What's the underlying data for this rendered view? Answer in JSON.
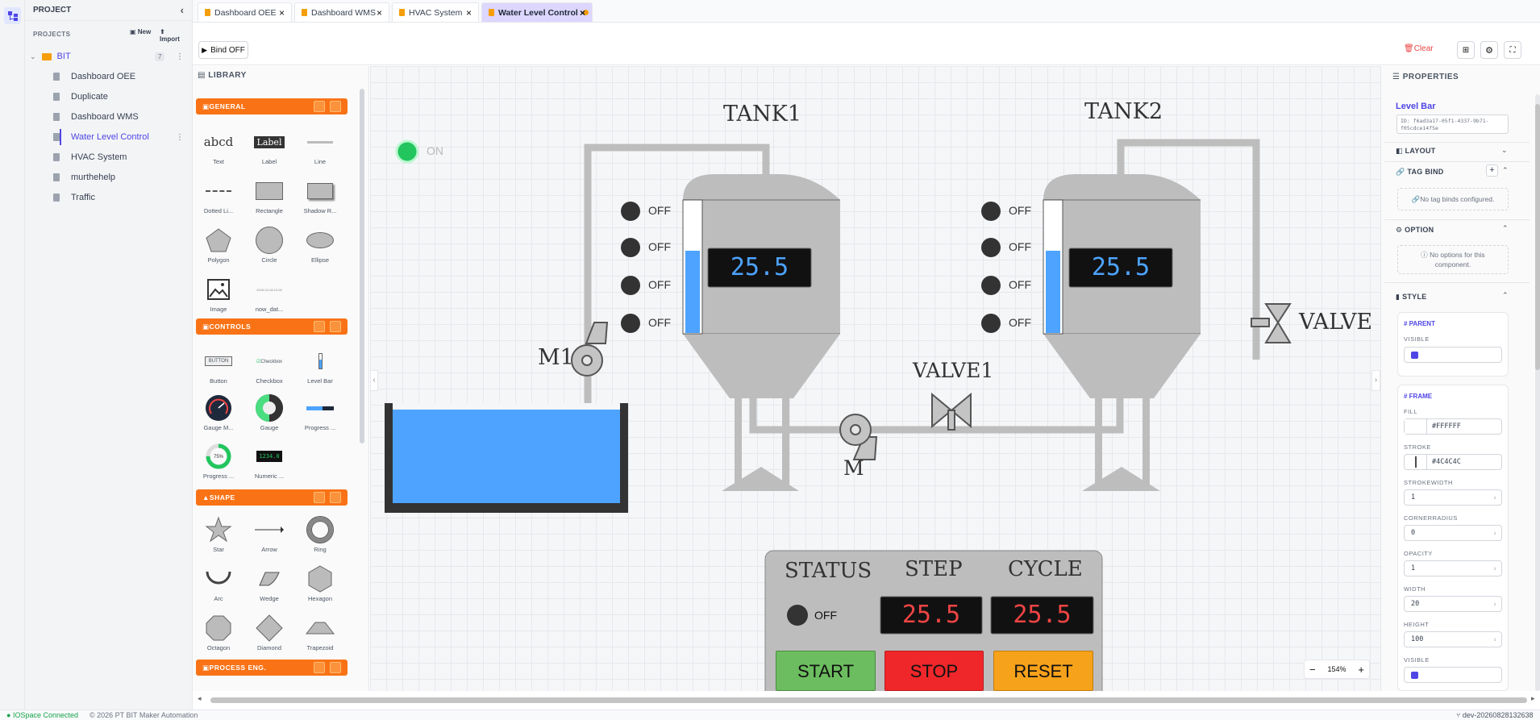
{
  "project": {
    "header": "PROJECT",
    "section": "PROJECTS",
    "new_label": "New",
    "import_label": "Import",
    "folder": "BIT",
    "folder_count": "7",
    "items": [
      "Dashboard OEE",
      "Duplicate",
      "Dashboard WMS",
      "Water Level Control",
      "HVAC System",
      "murthehelp",
      "Traffic"
    ],
    "active_item": "Water Level Control"
  },
  "tabs": [
    {
      "label": "Dashboard OEE"
    },
    {
      "label": "Dashboard WMS"
    },
    {
      "label": "HVAC System"
    },
    {
      "label": "Water Level Control"
    }
  ],
  "toolbar": {
    "bind_label": "Bind OFF",
    "clear_label": "Clear"
  },
  "library": {
    "title": "LIBRARY",
    "categories": [
      "GENERAL",
      "CONTROLS",
      "SHAPE",
      "PROCESS ENG."
    ],
    "general": [
      "Text",
      "Label",
      "Line",
      "Dotted Li...",
      "Rectangle",
      "Shadow R...",
      "Polygon",
      "Circle",
      "Ellipse",
      "Image",
      "now_dat..."
    ],
    "general_text_sample": "abcd",
    "general_label_sample": "Label",
    "general_date_sample": "2026-02-08 12:00",
    "controls": [
      "Button",
      "Checkbox",
      "Level Bar",
      "Gauge M...",
      "Gauge",
      "Progress ...",
      "Progress ...",
      "Numeric ..."
    ],
    "controls_button_sample": "BUTTON",
    "controls_checkbox_sample": "Checkbox",
    "controls_numeric_sample": "1234.0",
    "controls_progress_sample": "75%",
    "shape": [
      "Star",
      "Arrow",
      "Ring",
      "Arc",
      "Wedge",
      "Hexagon",
      "Octagon",
      "Diamond",
      "Trapezoid"
    ]
  },
  "canvas": {
    "on_label": "ON",
    "tank1_label": "TANK1",
    "tank2_label": "TANK2",
    "m1_label": "M1",
    "m_label": "M",
    "valve1_label": "VALVE1",
    "valve_label": "VALVE",
    "off_label": "OFF",
    "tank1_value": "25.5",
    "tank2_value": "25.5",
    "tank1_level": 0.62,
    "tank2_level": 0.62,
    "panel": {
      "status_label": "STATUS",
      "step_label": "STEP",
      "cycle_label": "CYCLE",
      "status_state": "OFF",
      "step_value": "25.5",
      "cycle_value": "25.5",
      "start_label": "START",
      "stop_label": "STOP",
      "reset_label": "RESET"
    },
    "zoom": "154%"
  },
  "properties": {
    "title": "PROPERTIES",
    "component": "Level Bar",
    "id": "ID: f6ad3a17-05f1-4337-9b71-f05cdce14f5e",
    "layout": "LAYOUT",
    "tag_bind": "TAG BIND",
    "no_tag_binds": "No tag binds configured.",
    "option": "OPTION",
    "no_options": "No options for this component.",
    "style": "STYLE",
    "parent": "# PARENT",
    "frame": "# FRAME",
    "visible": "VISIBLE",
    "fill": "FILL",
    "fill_value": "#FFFFFF",
    "stroke": "STROKE",
    "stroke_value": "#4C4C4C",
    "strokewidth": "STROKEWIDTH",
    "strokewidth_value": "1",
    "cornerradius": "CORNERRADIUS",
    "cornerradius_value": "0",
    "opacity": "OPACITY",
    "opacity_value": "1",
    "width": "WIDTH",
    "width_value": "20",
    "height": "HEIGHT",
    "height_value": "100",
    "visible2": "VISIBLE"
  },
  "status": {
    "connection": "IOSpace Connected",
    "copyright": "© 2026 PT BIT Maker Automation",
    "version": "dev-20260828132638"
  },
  "colors": {
    "accent": "#4f46e5",
    "category": "#f97316",
    "water": "#4da3ff",
    "tank": "#bdbdbd",
    "on_led": "#22c55e",
    "start": "#6cbd5f",
    "stop": "#f0272a",
    "reset": "#f7a21b"
  }
}
